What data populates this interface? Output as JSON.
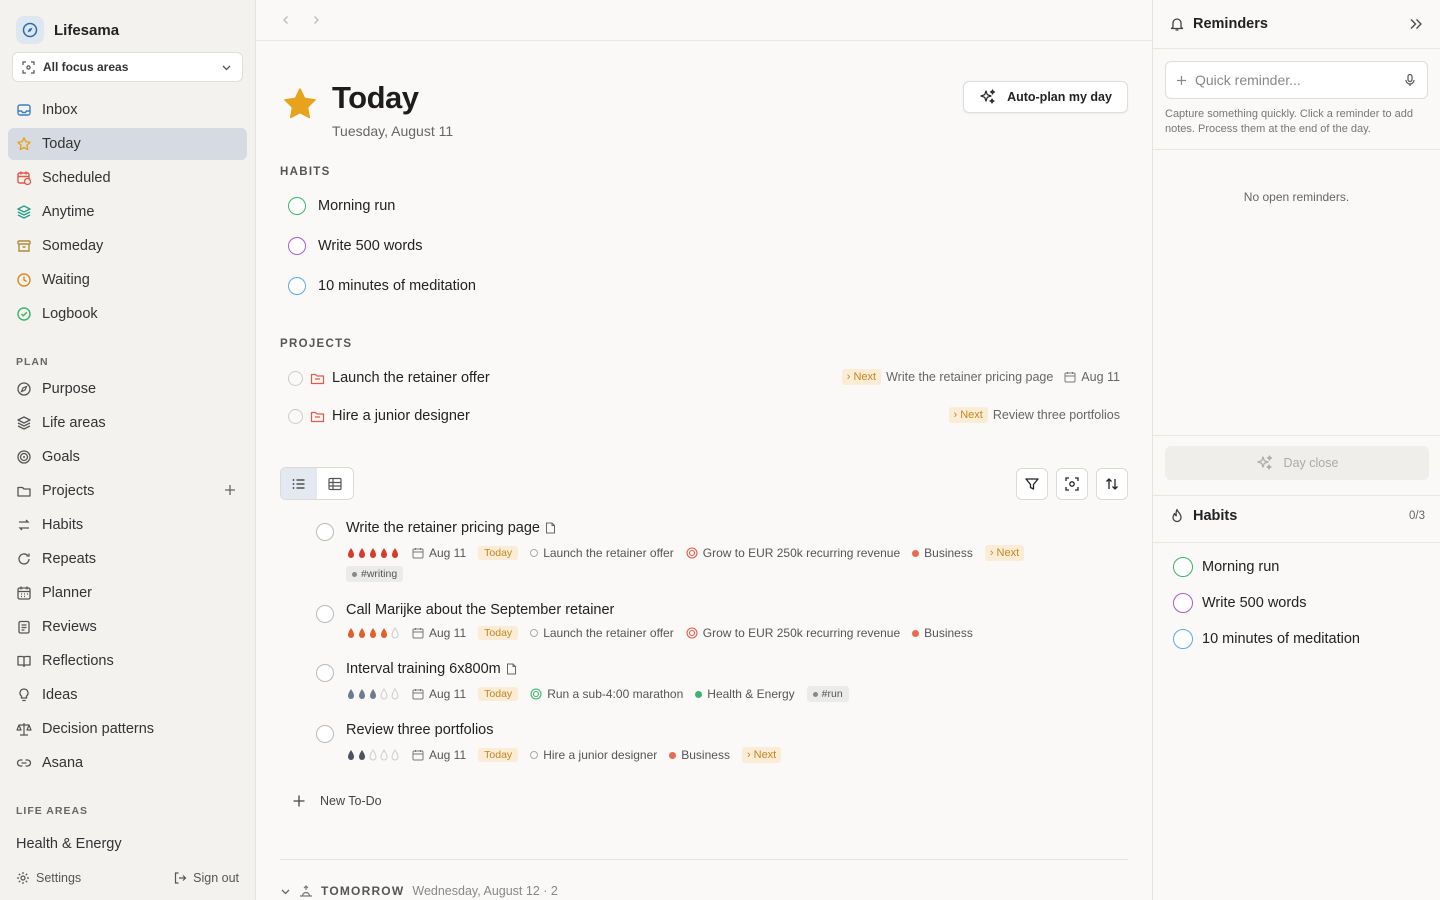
{
  "app": {
    "name": "Lifesama"
  },
  "sidebar": {
    "focus": "All focus areas",
    "nav": [
      {
        "label": "Inbox"
      },
      {
        "label": "Today"
      },
      {
        "label": "Scheduled"
      },
      {
        "label": "Anytime"
      },
      {
        "label": "Someday"
      },
      {
        "label": "Waiting"
      },
      {
        "label": "Logbook"
      }
    ],
    "plan_label": "PLAN",
    "plan": [
      {
        "label": "Purpose"
      },
      {
        "label": "Life areas"
      },
      {
        "label": "Goals"
      },
      {
        "label": "Projects"
      },
      {
        "label": "Habits"
      },
      {
        "label": "Repeats"
      },
      {
        "label": "Planner"
      },
      {
        "label": "Reviews"
      },
      {
        "label": "Reflections"
      },
      {
        "label": "Ideas"
      },
      {
        "label": "Decision patterns"
      },
      {
        "label": "Asana"
      }
    ],
    "life_areas_label": "LIFE AREAS",
    "life_areas": [
      {
        "label": "Health & Energy"
      }
    ],
    "settings": "Settings",
    "signout": "Sign out"
  },
  "main": {
    "title": "Today",
    "date": "Tuesday, August 11",
    "autoplan": "Auto-plan my day",
    "habits_label": "HABITS",
    "habits": [
      {
        "label": "Morning run",
        "color": "#3bb66a"
      },
      {
        "label": "Write 500 words",
        "color": "#a95ad0"
      },
      {
        "label": "10 minutes of meditation",
        "color": "#5aaee0"
      }
    ],
    "projects_label": "PROJECTS",
    "projects": [
      {
        "label": "Launch the retainer offer",
        "next": "Next",
        "next_task": "Write the retainer pricing page",
        "date": "Aug 11"
      },
      {
        "label": "Hire a junior designer",
        "next": "Next",
        "next_task": "Review three portfolios"
      }
    ],
    "todos": [
      {
        "title": "Write the retainer pricing page",
        "date": "Aug 11",
        "when": "Today",
        "project": "Launch the retainer offer",
        "goal": "Grow to EUR 250k recurring revenue",
        "area": "Business",
        "next": "Next",
        "tag": "#writing"
      },
      {
        "title": "Call Marijke about the September retainer",
        "date": "Aug 11",
        "when": "Today",
        "project": "Launch the retainer offer",
        "goal": "Grow to EUR 250k recurring revenue",
        "area": "Business"
      },
      {
        "title": "Interval training 6x800m",
        "date": "Aug 11",
        "when": "Today",
        "goal": "Run a sub-4:00 marathon",
        "area": "Health & Energy",
        "tag": "#run"
      },
      {
        "title": "Review three portfolios",
        "date": "Aug 11",
        "when": "Today",
        "project": "Hire a junior designer",
        "area": "Business",
        "next": "Next"
      }
    ],
    "new_todo": "New To-Do",
    "tomorrow_label": "TOMORROW",
    "tomorrow_date": "Wednesday, August 12 · 2"
  },
  "right": {
    "title": "Reminders",
    "quick_placeholder": "Quick reminder...",
    "hint": "Capture something quickly. Click a reminder to add notes. Process them at the end of the day.",
    "empty": "No open reminders.",
    "dayclose": "Day close",
    "habits_title": "Habits",
    "habits_count": "0/3",
    "habits": [
      {
        "label": "Morning run"
      },
      {
        "label": "Write 500 words"
      },
      {
        "label": "10 minutes of meditation"
      }
    ]
  },
  "colors": {
    "accent_star": "#e8a21c",
    "business": "#ec6a4c",
    "health": "#3bb66a",
    "next_bg": "#fbecd5",
    "next_fg": "#c48722",
    "active_nav": "#d6dae3"
  }
}
